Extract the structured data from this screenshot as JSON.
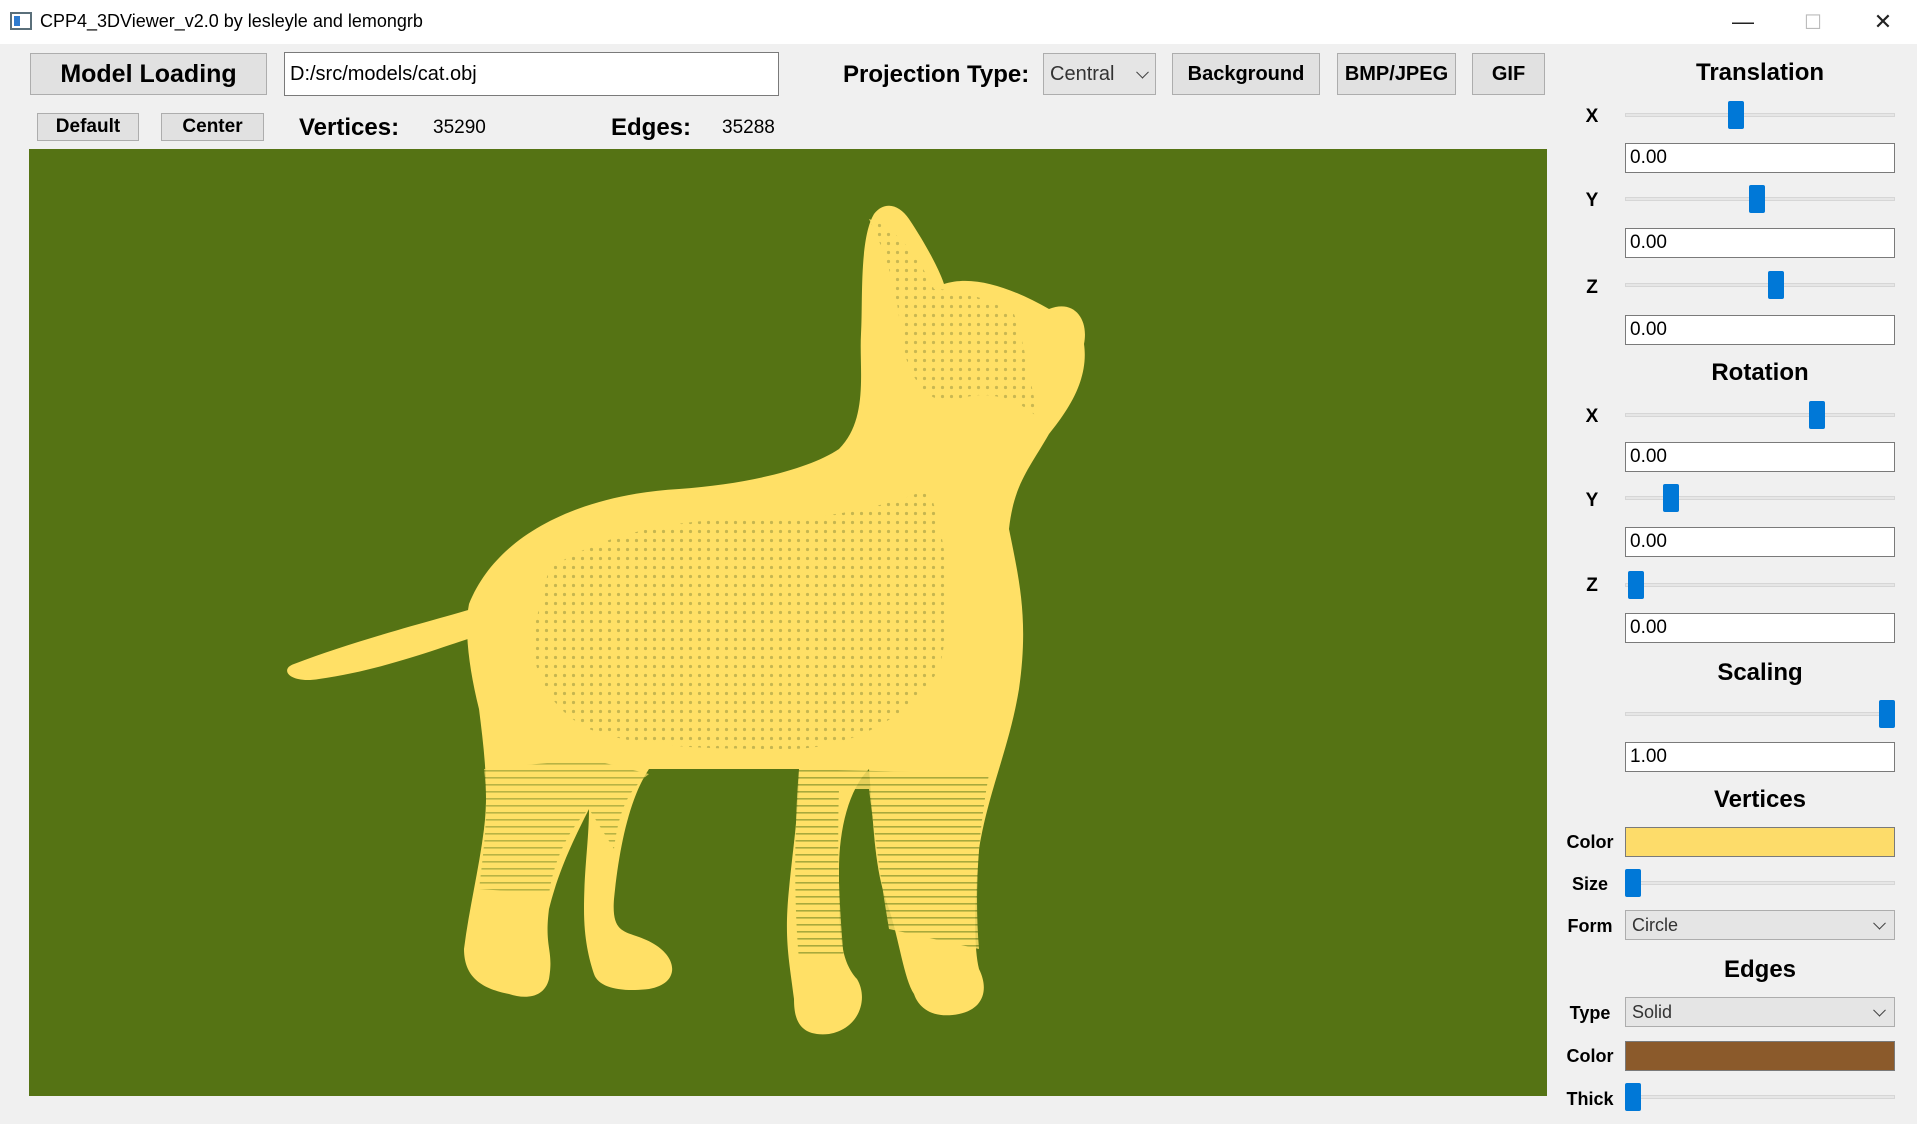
{
  "window": {
    "title": "CPP4_3DViewer_v2.0 by lesleyle and lemongrb",
    "minimize": "—",
    "maximize": "☐",
    "close": "✕"
  },
  "toolbar": {
    "model_loading": "Model Loading",
    "file_path": "D:/src/models/cat.obj",
    "projection_label": "Projection Type:",
    "projection_value": "Central",
    "background": "Background",
    "bmp_jpeg": "BMP/JPEG",
    "gif": "GIF",
    "default": "Default",
    "center": "Center",
    "vertices_label": "Vertices:",
    "vertices_count": "35290",
    "edges_label": "Edges:",
    "edges_count": "35288"
  },
  "viewport": {
    "background_color": "#557314",
    "model_color": "#ffe066"
  },
  "panel": {
    "translation": {
      "title": "Translation",
      "x_label": "X",
      "x_value": "0.00",
      "x_slider": 0.41,
      "y_label": "Y",
      "y_value": "0.00",
      "y_slider": 0.49,
      "z_label": "Z",
      "z_value": "0.00",
      "z_slider": 0.56
    },
    "rotation": {
      "title": "Rotation",
      "x_label": "X",
      "x_value": "0.00",
      "x_slider": 0.71,
      "y_label": "Y",
      "y_value": "0.00",
      "y_slider": 0.17,
      "z_label": "Z",
      "z_value": "0.00",
      "z_slider": 0.04
    },
    "scaling": {
      "title": "Scaling",
      "value": "1.00",
      "slider": 0.97
    },
    "vertices": {
      "title": "Vertices",
      "color_label": "Color",
      "color": "#fddc6a",
      "size_label": "Size",
      "size_slider": 0.03,
      "form_label": "Form",
      "form_value": "Circle"
    },
    "edges": {
      "title": "Edges",
      "type_label": "Type",
      "type_value": "Solid",
      "color_label": "Color",
      "color": "#8b5a2b",
      "thick_label": "Thick",
      "thick_slider": 0.03
    }
  }
}
